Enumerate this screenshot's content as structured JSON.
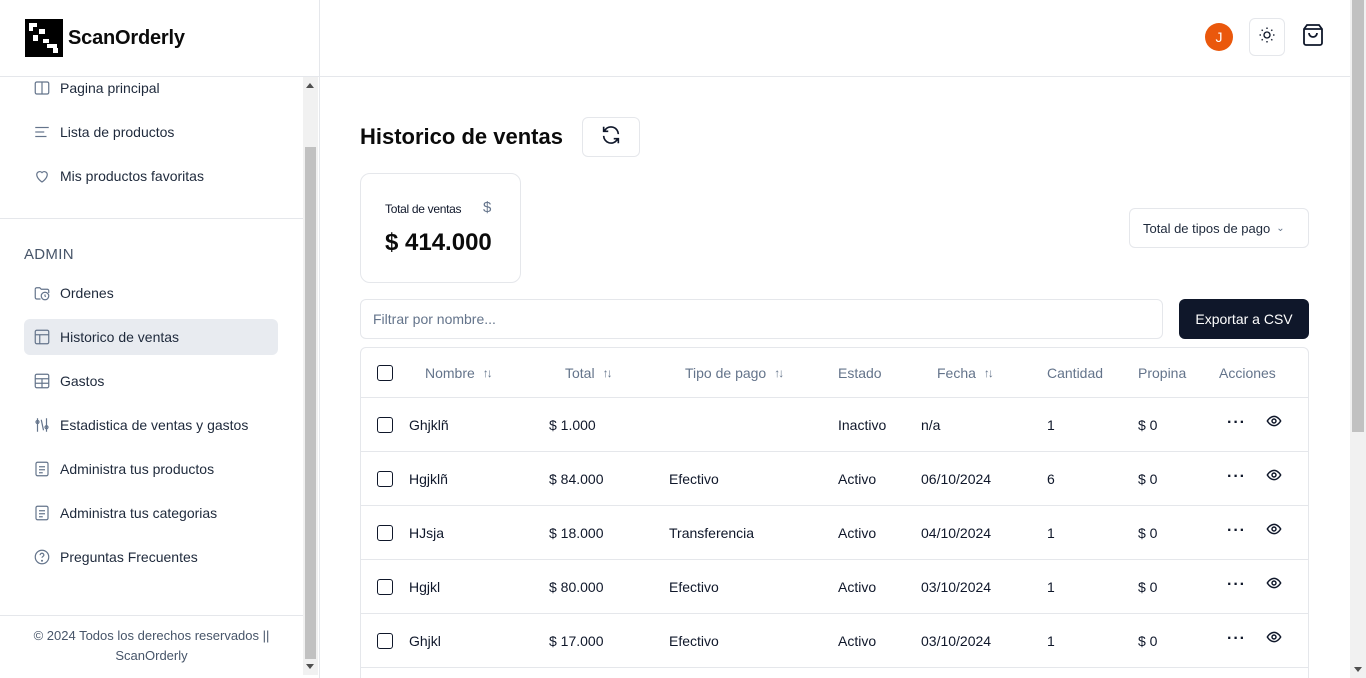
{
  "app": {
    "name": "ScanOrderly"
  },
  "sidebar": {
    "items": [
      {
        "label": "Pagina principal",
        "icon": "book-open-icon"
      },
      {
        "label": "Lista de productos",
        "icon": "list-icon"
      },
      {
        "label": "Mis productos favoritas",
        "icon": "heart-icon"
      }
    ],
    "admin_label": "ADMIN",
    "admin_items": [
      {
        "label": "Ordenes",
        "icon": "folder-clock-icon"
      },
      {
        "label": "Historico de ventas",
        "icon": "table-icon",
        "active": true
      },
      {
        "label": "Gastos",
        "icon": "grid-icon"
      },
      {
        "label": "Estadistica de ventas y gastos",
        "icon": "chart-icon"
      },
      {
        "label": "Administra tus productos",
        "icon": "file-text-icon"
      },
      {
        "label": "Administra tus categorias",
        "icon": "file-text-icon"
      },
      {
        "label": "Preguntas Frecuentes",
        "icon": "help-circle-icon"
      }
    ],
    "footer_line1": "© 2024 Todos los derechos reservados ||",
    "footer_line2": "ScanOrderly"
  },
  "header": {
    "avatar_initial": "J"
  },
  "main": {
    "title": "Historico de ventas",
    "card": {
      "label": "Total de ventas",
      "currency_symbol": "$",
      "value": "$ 414.000"
    },
    "payment_select": "Total de tipos de pago",
    "filter_placeholder": "Filtrar por nombre...",
    "export_label": "Exportar a CSV"
  },
  "table": {
    "headers": {
      "nombre": "Nombre",
      "total": "Total",
      "tipo": "Tipo de pago",
      "estado": "Estado",
      "fecha": "Fecha",
      "cantidad": "Cantidad",
      "propina": "Propina",
      "acciones": "Acciones"
    },
    "rows": [
      {
        "nombre": "Ghjklñ",
        "total": "$ 1.000",
        "tipo": "",
        "estado": "Inactivo",
        "fecha": "n/a",
        "cantidad": "1",
        "propina": "$ 0"
      },
      {
        "nombre": "Hgjklñ",
        "total": "$ 84.000",
        "tipo": "Efectivo",
        "estado": "Activo",
        "fecha": "06/10/2024",
        "cantidad": "6",
        "propina": "$ 0"
      },
      {
        "nombre": "HJsja",
        "total": "$ 18.000",
        "tipo": "Transferencia",
        "estado": "Activo",
        "fecha": "04/10/2024",
        "cantidad": "1",
        "propina": "$ 0"
      },
      {
        "nombre": "Hgjkl",
        "total": "$ 80.000",
        "tipo": "Efectivo",
        "estado": "Activo",
        "fecha": "03/10/2024",
        "cantidad": "1",
        "propina": "$ 0"
      },
      {
        "nombre": "Ghjkl",
        "total": "$ 17.000",
        "tipo": "Efectivo",
        "estado": "Activo",
        "fecha": "03/10/2024",
        "cantidad": "1",
        "propina": "$ 0"
      }
    ]
  }
}
